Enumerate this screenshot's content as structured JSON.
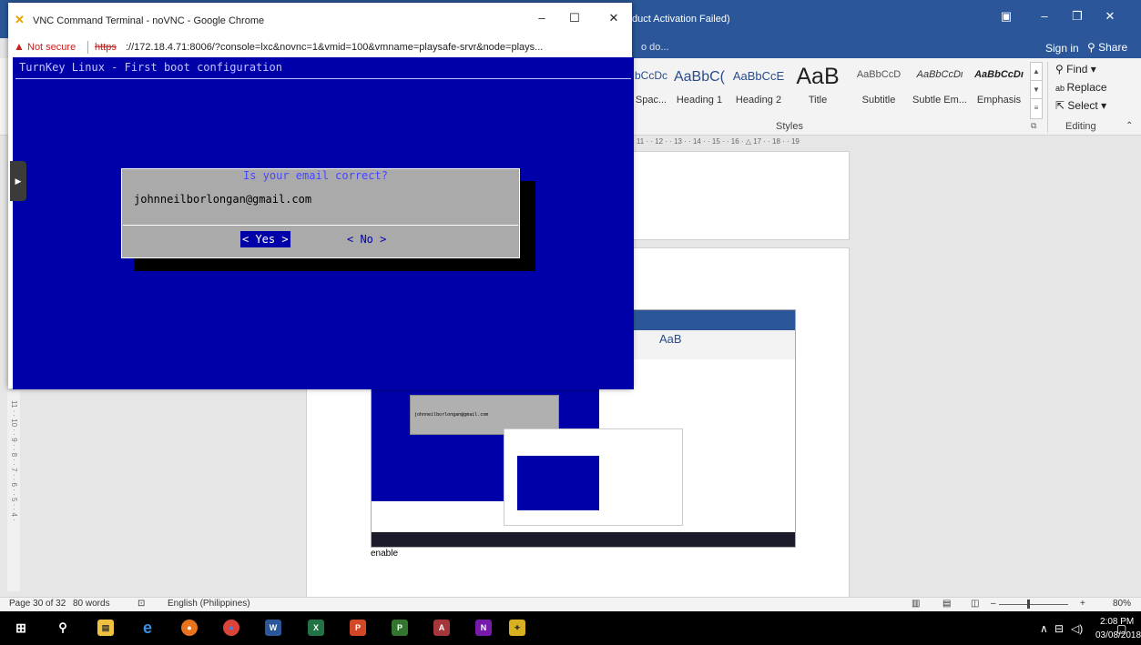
{
  "word": {
    "title": "duct Activation Failed)",
    "tell_me": "o do...",
    "sign_in": "Sign in",
    "share": "Share",
    "styles": [
      {
        "sample": "bCcDc",
        "name": "Spac..."
      },
      {
        "sample": "AaBbC(",
        "name": "Heading 1"
      },
      {
        "sample": "AaBbCcE",
        "name": "Heading 2"
      },
      {
        "sample": "AaB",
        "name": "Title"
      },
      {
        "sample": "AaBbCcD",
        "name": "Subtitle"
      },
      {
        "sample": "AaBbCcDι",
        "name": "Subtle Em..."
      },
      {
        "sample": "AaBbCcDι",
        "name": "Emphasis"
      }
    ],
    "styles_label": "Styles",
    "editing": {
      "find": "Find",
      "replace": "Replace",
      "select": "Select",
      "label": "Editing"
    },
    "ruler": "· 11 · · 12 · · 13 · · 14 · · 15 · · 16 · △ 17 · · 18 · · 19",
    "vruler": "11 · · 10 · · 9 · · 8 · · 7 · · 6 · · 5 · · 4 ·",
    "inner_text": "enable",
    "inner_email": "johnneilborlongan@gmail.com",
    "status": {
      "page": "Page 30 of 32",
      "words": "80 words",
      "language": "English (Philippines)",
      "zoom": "80%"
    }
  },
  "taskbar": {
    "apps": [
      "start",
      "search",
      "file-explorer",
      "edge",
      "firefox",
      "chrome",
      "word",
      "excel",
      "powerpoint",
      "project",
      "access",
      "onenote",
      "other"
    ],
    "time": "2:08 PM",
    "date": "03/08/2018"
  },
  "chrome": {
    "title": "VNC Command Terminal - noVNC - Google Chrome",
    "not_secure": "Not secure",
    "url_scheme": "https",
    "url_rest": "://172.18.4.71:8006/?console=lxc&novnc=1&vmid=100&vmname=playsafe-srvr&node=plays..."
  },
  "console": {
    "header": "TurnKey Linux - First boot configuration",
    "dialog_title": "Is your email correct?",
    "email": "johnneilborlongan@gmail.com",
    "yes": "< Yes >",
    "no": "< No  >"
  },
  "colors": {
    "word_blue": "#2b579a",
    "console_blue": "#0000a8",
    "dialog_gray": "#aaaaaa"
  }
}
